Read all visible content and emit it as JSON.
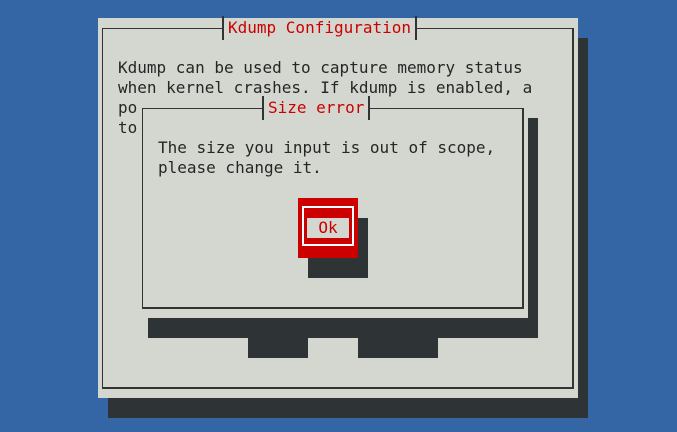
{
  "main_dialog": {
    "title": "Kdump Configuration",
    "lines": [
      "Kdump can be used to capture memory status",
      "when kernel crashes. If kdump is enabled, a",
      "po",
      "to"
    ]
  },
  "error_dialog": {
    "title": "Size error",
    "lines": [
      "The size you input is out of scope,",
      "please change it."
    ],
    "ok_label": "Ok"
  },
  "colors": {
    "background": "#3465a4",
    "panel": "#d3d7cf",
    "accent": "#cc0000",
    "shadow": "#2e3436"
  }
}
